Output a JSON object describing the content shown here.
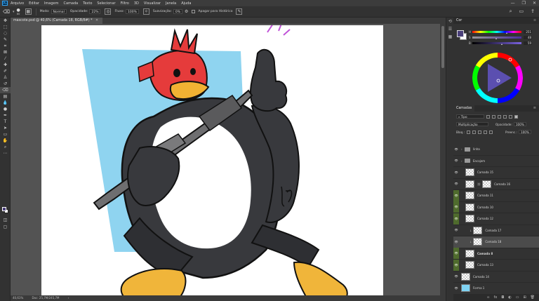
{
  "menubar": {
    "logo": "Ps",
    "items": [
      "Arquivo",
      "Editar",
      "Imagem",
      "Camada",
      "Texto",
      "Selecionar",
      "Filtro",
      "3D",
      "Visualizar",
      "Janela",
      "Ajuda"
    ],
    "controls": [
      "—",
      "❐",
      "✕"
    ]
  },
  "options": {
    "brush_size": "80",
    "mode_label": "Modo:",
    "mode_value": "Normal",
    "opacity_label": "Opacidade:",
    "opacity_value": "22%",
    "flow_label": "Fluxo:",
    "flow_value": "100%",
    "smoothing_label": "Suavização:",
    "smoothing_value": "0%",
    "sample_all_label": "Apagar para Histórico"
  },
  "document": {
    "tab_title": "mascote.psd @ 40,6% (Camada 18, RGB/8#) *",
    "close": "✕"
  },
  "status": {
    "zoom": "40,61%",
    "doc_info": "Doc: 25,7M/245,7M"
  },
  "color_panel": {
    "title": "Cor",
    "fg_color": "#4a3f7a",
    "bg_color": "#ffffff",
    "sliders": [
      {
        "label": "H",
        "value": "251"
      },
      {
        "label": "S",
        "value": "48"
      },
      {
        "label": "B",
        "value": "59"
      }
    ]
  },
  "layers_panel": {
    "tabs": [
      "Camadas"
    ],
    "filter_label": "Tipo",
    "blend_mode": "Multiplicação",
    "opacity_label": "Opacidade:",
    "opacity_value": "100%",
    "lock_label": "Bloq.:",
    "fill_label": "Preenc.:",
    "fill_value": "100%",
    "layers": [
      {
        "name": "linha",
        "type": "folder",
        "visible": false,
        "indent": 0,
        "selected": false
      },
      {
        "name": "Encajem",
        "type": "folder",
        "visible": false,
        "indent": 0,
        "selected": false
      },
      {
        "name": "Camada 15",
        "type": "layer",
        "visible": false,
        "indent": 1,
        "selected": false
      },
      {
        "name": "Camada 16",
        "type": "layer-linked",
        "visible": false,
        "indent": 1,
        "selected": false
      },
      {
        "name": "Camada 11",
        "type": "layer",
        "visible": true,
        "indent": 1,
        "selected": false
      },
      {
        "name": "Camada 10",
        "type": "layer",
        "visible": true,
        "indent": 1,
        "selected": false
      },
      {
        "name": "Camada 12",
        "type": "layer",
        "visible": true,
        "indent": 1,
        "selected": false
      },
      {
        "name": "Camada 17",
        "type": "layer-clip",
        "visible": false,
        "indent": 2,
        "selected": false
      },
      {
        "name": "Camada 18",
        "type": "layer-clip",
        "visible": false,
        "indent": 2,
        "selected": true
      },
      {
        "name": "Camada 8",
        "type": "layer",
        "visible": true,
        "indent": 1,
        "selected": false
      },
      {
        "name": "Camada 13",
        "type": "layer",
        "visible": true,
        "indent": 1,
        "selected": false
      },
      {
        "name": "Camada 14",
        "type": "layer",
        "visible": false,
        "indent": 0,
        "selected": false
      },
      {
        "name": "Forma 1",
        "type": "shape",
        "visible": false,
        "indent": 0,
        "selected": false
      },
      {
        "name": "Camada 1",
        "type": "layer",
        "visible": false,
        "indent": 0,
        "selected": false
      }
    ],
    "footer_icons": [
      "link-icon",
      "fx-icon",
      "mask-icon",
      "adjustment-icon",
      "folder-icon",
      "new-layer-icon",
      "trash-icon"
    ]
  },
  "canvas": {
    "bg_shape_color": "#8fd4f0",
    "accent_red": "#e53b3b",
    "beak_color": "#f2b233",
    "body_color": "#3a3a3e"
  }
}
